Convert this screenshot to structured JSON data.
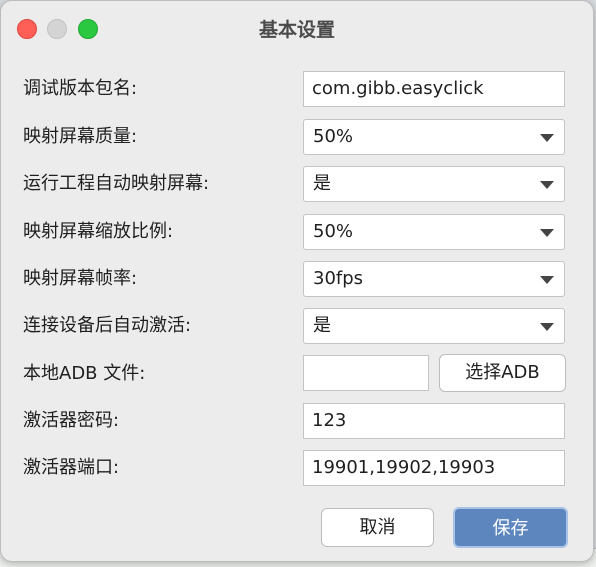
{
  "window": {
    "title": "基本设置"
  },
  "form": {
    "debug_package": {
      "label": "调试版本包名:",
      "value": "com.gibb.easyclick"
    },
    "mirror_quality": {
      "label": "映射屏幕质量:",
      "value": "50%"
    },
    "auto_mirror_on_run": {
      "label": "运行工程自动映射屏幕:",
      "value": "是"
    },
    "mirror_scale": {
      "label": "映射屏幕缩放比例:",
      "value": "50%"
    },
    "mirror_framerate": {
      "label": "映射屏幕帧率:",
      "value": "30fps"
    },
    "auto_activate_after_connect": {
      "label": "连接设备后自动激活:",
      "value": "是"
    },
    "local_adb_file": {
      "label": "本地ADB 文件:",
      "value": "",
      "button_label": "选择ADB"
    },
    "activator_password": {
      "label": "激活器密码:",
      "value": "123"
    },
    "activator_ports": {
      "label": "激活器端口:",
      "value": "19901,19902,19903"
    }
  },
  "actions": {
    "cancel_label": "取消",
    "save_label": "保存"
  },
  "colors": {
    "accent": "#5d86bf",
    "close": "#ff5f57",
    "maximize": "#2ac740"
  }
}
